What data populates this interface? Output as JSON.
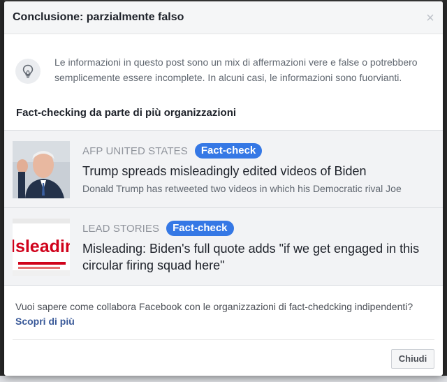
{
  "dialog": {
    "title": "Conclusione: parzialmente falso",
    "close_icon": "close-icon",
    "info_icon": "lightbulb-icon",
    "info_text": "Le informazioni in questo post sono un mix di affermazioni vere e false o potrebbero semplicemente essere incomplete. In alcuni casi, le informazioni sono fuorvianti.",
    "section_title": "Fact-checking da parte di più organizzazioni",
    "items": [
      {
        "source": "AFP UNITED STATES",
        "badge": "Fact-check",
        "headline": "Trump spreads misleadingly edited videos of Biden",
        "snippet": "Donald Trump has retweeted two videos in which his Democratic rival Joe"
      },
      {
        "source": "LEAD STORIES",
        "badge": "Fact-check",
        "headline": "Misleading: Biden's full quote adds \"if we get engaged in this circular firing squad here\"",
        "thumb_text": "lsleadin"
      }
    ],
    "footer_text": "Vuoi sapere come collabora Facebook con le organizzazioni di fact-chedcking indipendenti?",
    "learn_more": "Scopri di più",
    "close_button": "Chiudi"
  },
  "colors": {
    "badge": "#3578e5",
    "link": "#385898",
    "header_bg": "#f5f6f7",
    "item_bg": "#f2f3f5"
  }
}
